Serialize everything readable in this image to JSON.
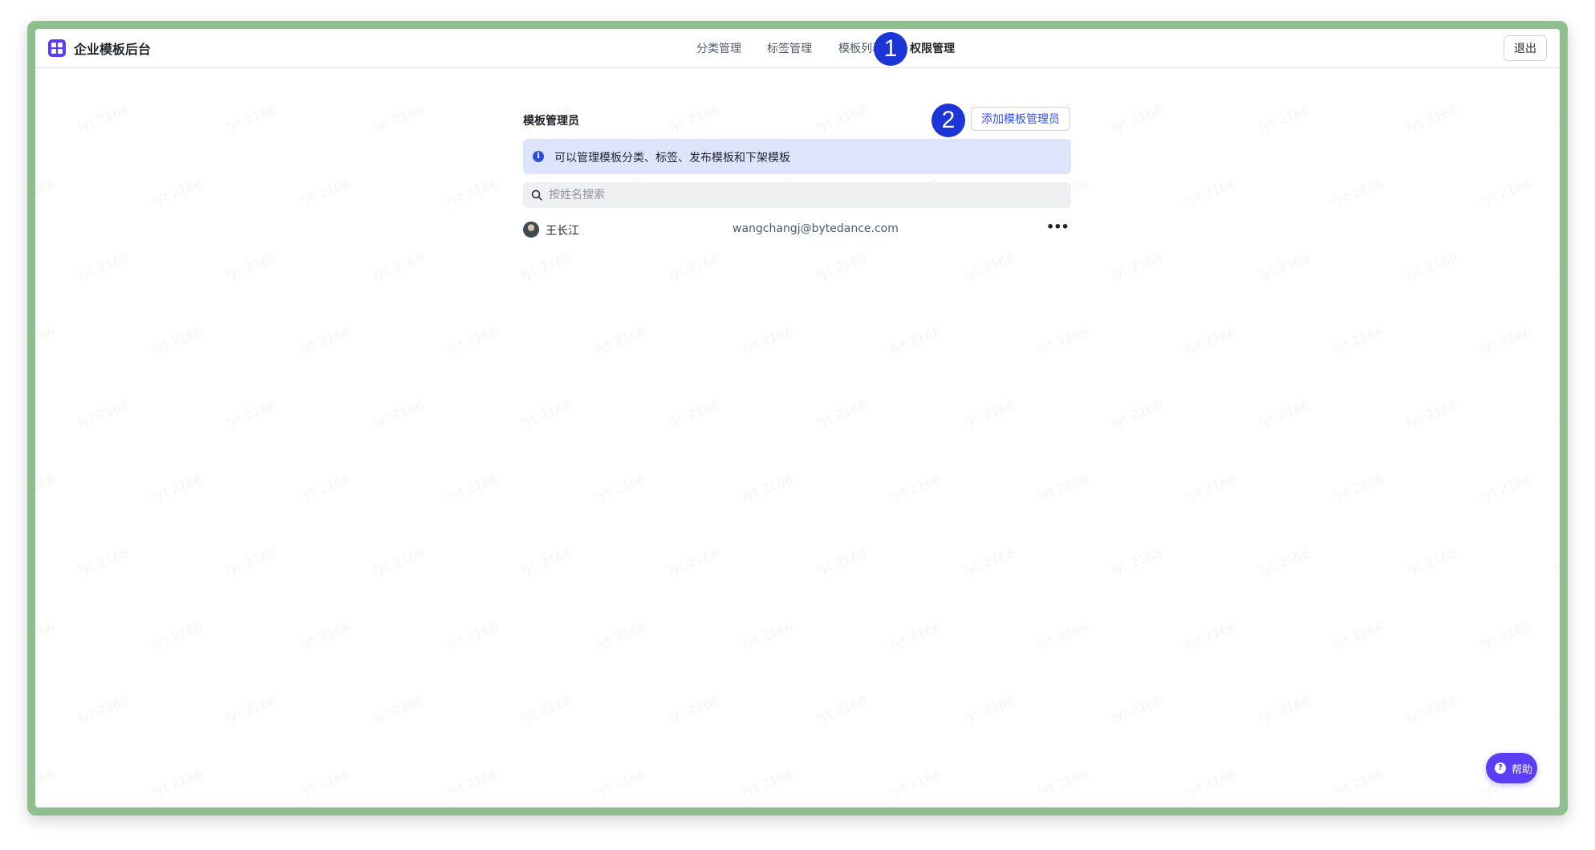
{
  "app": {
    "title": "企业模板后台"
  },
  "nav": {
    "tabs": [
      {
        "label": "分类管理",
        "active": false
      },
      {
        "label": "标签管理",
        "active": false
      },
      {
        "label": "模板列表",
        "active": false
      },
      {
        "label": "权限管理",
        "active": true
      }
    ],
    "logout_label": "退出"
  },
  "markers": {
    "m1": "1",
    "m2": "2"
  },
  "section": {
    "title": "模板管理员",
    "add_button_label": "添加模板管理员"
  },
  "info": {
    "icon": "info-icon",
    "text": "可以管理模板分类、标签、发布模板和下架模板"
  },
  "search": {
    "placeholder": "按姓名搜索",
    "value": ""
  },
  "members": [
    {
      "name": "王长江",
      "email": "wangchangj@bytedance.com"
    }
  ],
  "help": {
    "label": "帮助",
    "icon": "?"
  },
  "watermark": {
    "text": "lyt 2166"
  },
  "colors": {
    "accent": "#5b3df5",
    "link": "#3250e6",
    "banner_bg": "#dde5fd",
    "frame": "#8fbf8f",
    "marker": "#1b35d6"
  }
}
